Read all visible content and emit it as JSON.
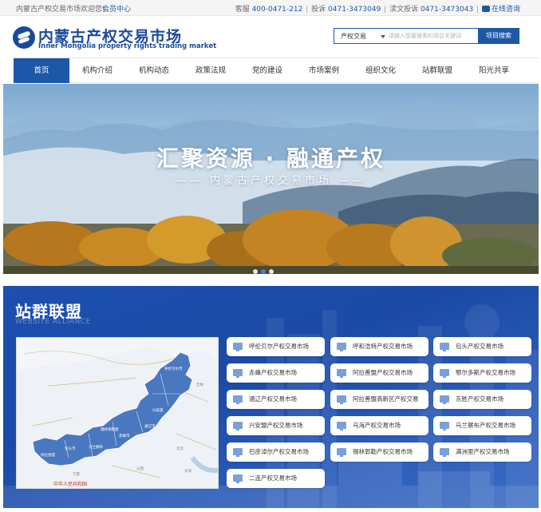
{
  "topbar": {
    "welcome": "内蒙古产权交易市场欢迎您!",
    "member_center": "会员中心",
    "hotline_label": "客服",
    "hotline": "400-0471-212",
    "complaint_label": "投诉",
    "complaint": "0471-3473049",
    "report_label": "渎文投诉",
    "report": "0471-3473043",
    "online": "在线咨询",
    "chat_icon": "chat-icon"
  },
  "header": {
    "logo_cn": "内蒙古产权交易市场",
    "logo_en": "Inner Mongolia property rights trading market",
    "logo_icon": "logo-mark"
  },
  "search": {
    "scope": "产权交易",
    "placeholder": "请输入您要搜索的项目关键词",
    "button": "项目搜索"
  },
  "nav": {
    "items": [
      "首页",
      "机构介绍",
      "机构动态",
      "政策法规",
      "党的建设",
      "市场案例",
      "组织文化",
      "站群联盟",
      "阳光共享"
    ],
    "active_index": 0
  },
  "banner": {
    "title": "汇聚资源 · 融通产权",
    "subtitle": "—— 内蒙古产权交易市场 ——",
    "slide_count": 3,
    "active_slide": 1
  },
  "alliance": {
    "title": "站群联盟",
    "subtitle": "WEBSITE ALLIANCE",
    "map_caption": "中华人民共和国",
    "sites": [
      "呼伦贝尔产权交易市场",
      "呼和浩特产权交易市场",
      "包头产权交易市场",
      "赤峰产权交易市场",
      "阿拉善盟产权交易市场",
      "鄂尔多斯产权交易市场",
      "通辽产权交易市场",
      "阿拉善盟高新区产权交易",
      "东胜产权交易市场",
      "兴安盟产权交易市场",
      "乌海产权交易市场",
      "乌兰察布产权交易市场",
      "巴彦淖尔产权交易市场",
      "锡林郭勒产权交易市场",
      "满洲里产权交易市场",
      "二连产权交易市场"
    ],
    "site_icon": "monitor-icon"
  },
  "colors": {
    "brand_blue": "#1d57a7",
    "alliance_bg": "#1d4fb0",
    "map_fill": "#4a78c0"
  }
}
